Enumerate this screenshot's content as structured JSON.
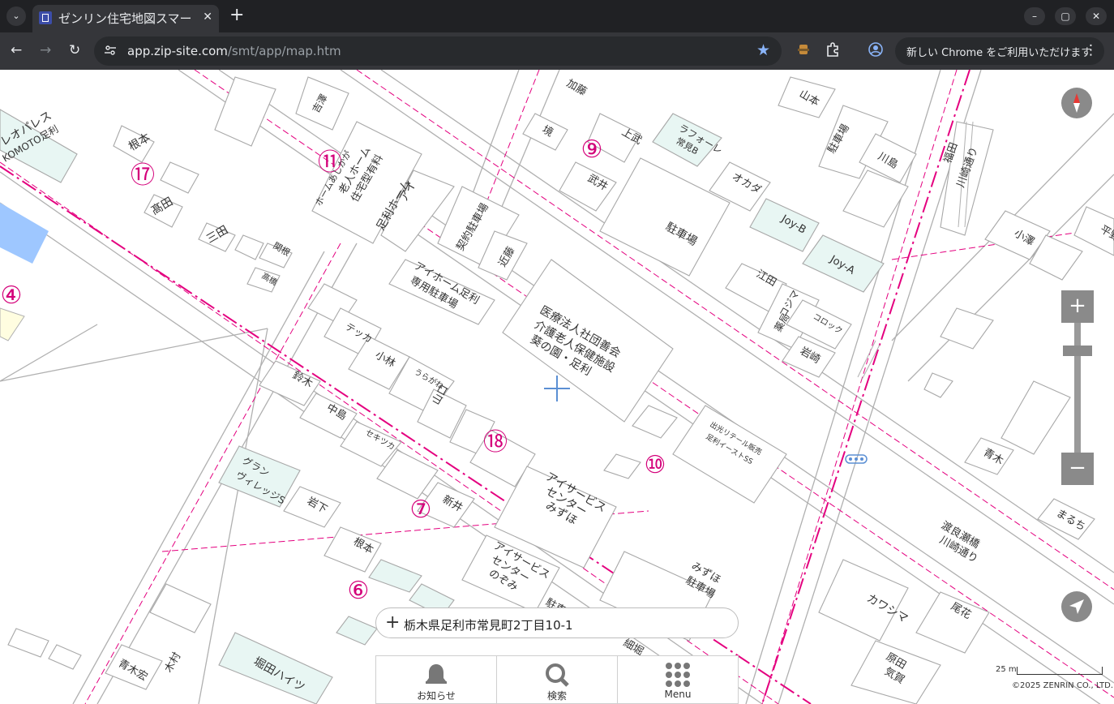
{
  "browser": {
    "tab_title": "ゼンリン住宅地図スマー",
    "url_host": "app.zip-site.com",
    "url_path": "/smt/app/map.htm",
    "update_label": "新しい Chrome をご利用いただけます"
  },
  "map": {
    "block_numbers": [
      "⑪",
      "⑨",
      "⑰",
      "④",
      "⑱",
      "⑩",
      "⑦",
      "⑥"
    ],
    "labels": {
      "l1": "レオパレス",
      "l2": "KOMOTO足利",
      "l3": "根本",
      "l4": "髙田",
      "l5": "三田",
      "l6": "吉澤",
      "l7": "住宅型有料",
      "l8": "老人ホーム",
      "l9": "ホームあしかが",
      "l10": "アイ",
      "l11": "足利ホーム",
      "l12": "契約駐車場",
      "l13": "近藤",
      "l14": "アイホーム足利",
      "l15": "専用駐車場",
      "l16": "加藤",
      "l17": "境",
      "l18": "上武",
      "l19": "ラフォーレ",
      "l20": "常見B",
      "l21": "武井",
      "l22": "オカダ",
      "l23": "駐車場",
      "l24": "山本",
      "l25": "駐車場",
      "l26": "川島",
      "l27": "福田",
      "l28": "川崎通り",
      "l29": "Joy-B",
      "l30": "Joy-A",
      "l31": "江田",
      "l32": "コジマ",
      "l33": "薬局",
      "l34": "コロック",
      "l35": "岩崎",
      "l36": "小澤",
      "l37": "平野",
      "l38": "医療法人社団善会",
      "l39": "介護老人保健施設",
      "l40": "葵の園・足利",
      "l41": "テッカ",
      "l42": "小林",
      "l43": "鈴木",
      "l44": "中島",
      "l45": "山口",
      "l46": "セキツカ",
      "l47": "グラン",
      "l48": "ヴィレッジS",
      "l49": "岩下",
      "l50": "新井",
      "l51": "根本",
      "l52": "アイサービス",
      "l53": "センター",
      "l54": "みずほ",
      "l55": "アイサービス",
      "l56": "センター",
      "l57": "のぞみ",
      "l58": "みずほ",
      "l59": "駐車場",
      "l60": "渡良瀬橋",
      "l61": "川崎通り",
      "l62": "まるち",
      "l63": "青木",
      "l64": "カワシマ",
      "l65": "尾花",
      "l66": "原田",
      "l67": "気賀",
      "l68": "青木宏",
      "l69": "木村",
      "l70": "堀田ハイツ",
      "l71": "細堀",
      "l72": "関根",
      "l73": "高橋",
      "l74": "うらがね",
      "l75": "出光リテール販売",
      "l76": "足利イーストSS",
      "l77": "駐車場"
    }
  },
  "controls": {
    "zoom_in": "+",
    "zoom_out": "−",
    "zoom_level": 0.82,
    "scale_label": "25 m",
    "copyright": "©2025 ZENRIN CO., LTD."
  },
  "address": {
    "plus": "+",
    "text": "栃木県足利市常見町2丁目10-1"
  },
  "bottom_menu": [
    {
      "label": "お知らせ",
      "icon": "bell-icon"
    },
    {
      "label": "検索",
      "icon": "search-icon"
    },
    {
      "label": "Menu",
      "icon": "grid-menu-icon"
    }
  ],
  "colors": {
    "road": "#b0b0b0",
    "boundary": "#e4007f",
    "block_number": "#d4007a",
    "water": "#9ec7ff",
    "highlight": "#e8f6f3",
    "control": "#8a8a8a"
  }
}
